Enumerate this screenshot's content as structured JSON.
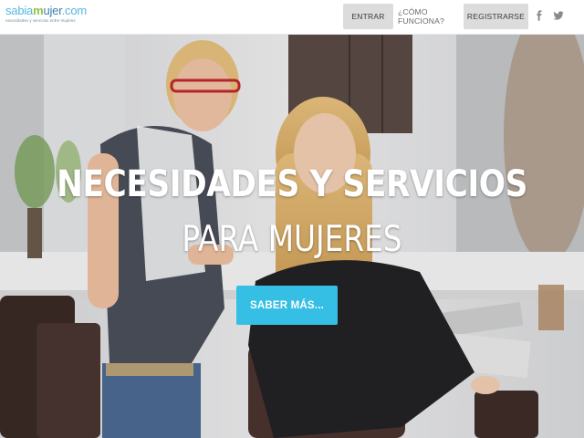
{
  "header": {
    "logo": {
      "brand_prefix": "sabia",
      "brand_mid": "m",
      "brand_rest": "ujer",
      "brand_suffix": ".com",
      "tagline": "necesidades y servicios entre mujeres"
    },
    "nav": {
      "login_label": "ENTRAR",
      "how_label": "¿CÓMO FUNCIONA?",
      "register_label": "REGISTRARSE"
    },
    "social": [
      {
        "icon": "facebook-icon"
      },
      {
        "icon": "twitter-icon"
      }
    ]
  },
  "hero": {
    "title": "NECESIDADES Y SERVICIOS",
    "subtitle": "PARA MUJERES",
    "cta_label": "SABER MÁS..."
  },
  "colors": {
    "accent": "#36bfe4",
    "logo_blue": "#55b6df",
    "logo_green": "#8cc63f",
    "nav_button_bg": "#dcdcdc"
  }
}
